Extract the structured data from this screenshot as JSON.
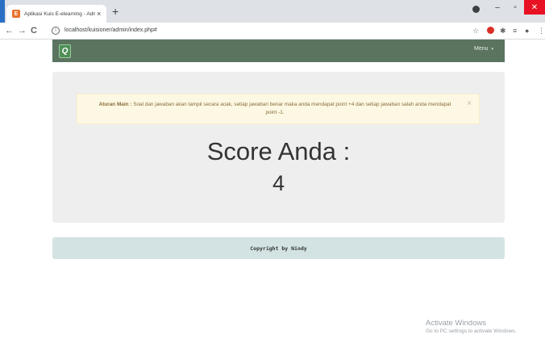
{
  "browser": {
    "tab_title": "Aplikasi Kuis E-elearning - Admin",
    "tab_close": "×",
    "new_tab": "+",
    "url": "localhost/kuisioner/admin/index.php#",
    "favicon_letter": "E",
    "back": "←",
    "forward": "→",
    "reload": "C",
    "info": "i",
    "star": "☆",
    "extensions": "✱",
    "reading_list": "≡",
    "account": "●",
    "more": "⋮",
    "minimize": "–",
    "maximize": "▫",
    "close": "✕"
  },
  "navbar": {
    "brand": "Q",
    "menu_label": "Menu",
    "menu_caret": "▾"
  },
  "alert": {
    "title": "Aturan Main :",
    "text": "Soal dan jawaban akan tampil secara acak, setiap jawaban benar maka anda mendapat point +4 dan setiap jawaban salah anda mendapat point -1.",
    "close": "×"
  },
  "score": {
    "title": "Score Anda :",
    "value": "4"
  },
  "footer": {
    "text": "Copyright by Nindy"
  },
  "watermark": {
    "line1": "Activate Windows",
    "line2": "Go to PC settings to activate Windows."
  },
  "colors": {
    "navbar": "#5a7460",
    "alert_bg": "#fcf8e3",
    "footer_bg": "#d3e3e3",
    "tab_accent": "#2b6fc4"
  }
}
